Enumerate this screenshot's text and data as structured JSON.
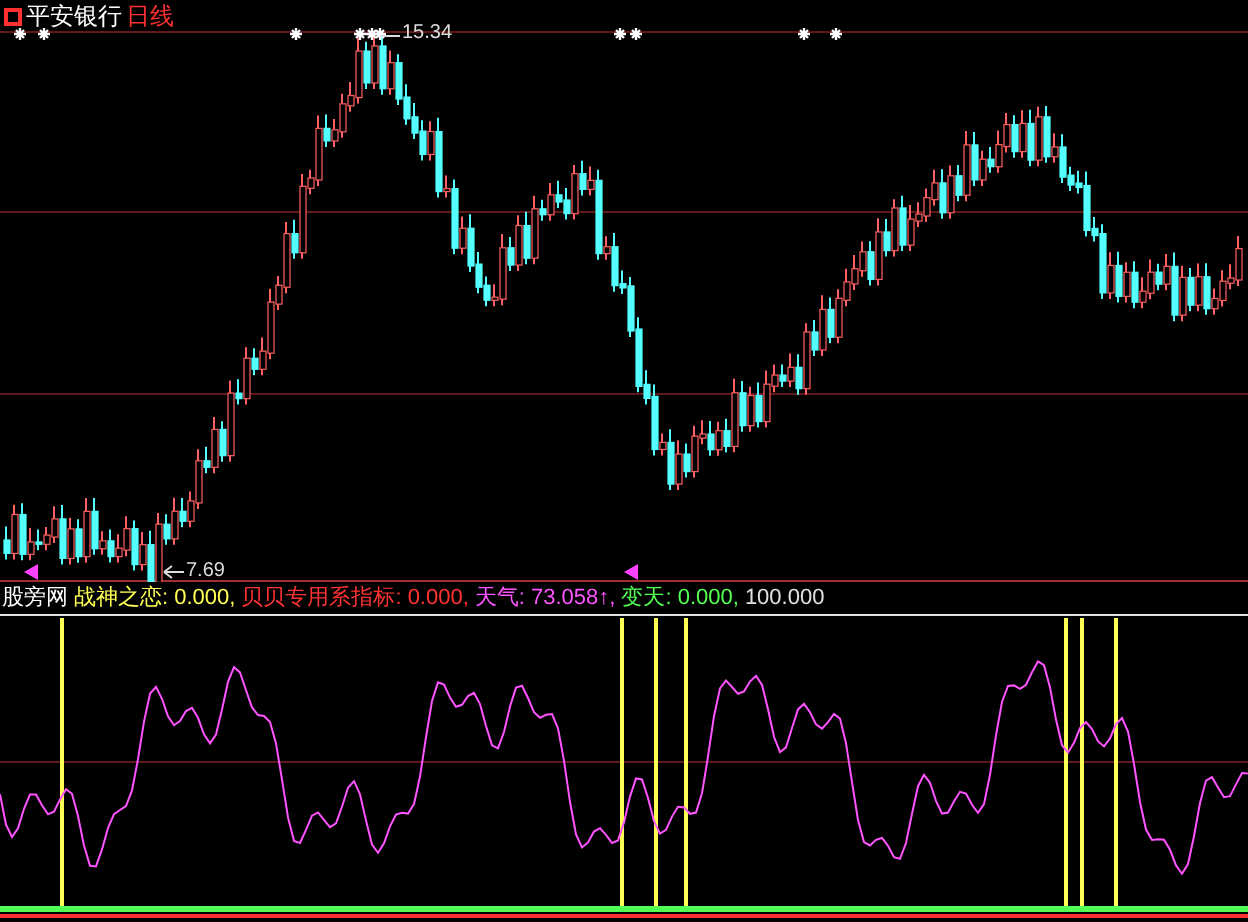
{
  "price_panel": {
    "title": {
      "stock": "平安银行",
      "period": "日线"
    },
    "high_label": "15.34",
    "low_label": "7.69"
  },
  "indicator_panel": {
    "name": "股旁网",
    "legend": [
      {
        "text": "战神之恋: 0.000,",
        "color": "#ffff54"
      },
      {
        "text": "贝贝专用系指标: 0.000,",
        "color": "#ff3232"
      },
      {
        "text": "天气: 73.058↑,",
        "color": "#ff54ff"
      },
      {
        "text": "变天: 0.000,",
        "color": "#54ff54"
      },
      {
        "text": "100.000",
        "color": "#e0e0e0"
      }
    ]
  }
}
